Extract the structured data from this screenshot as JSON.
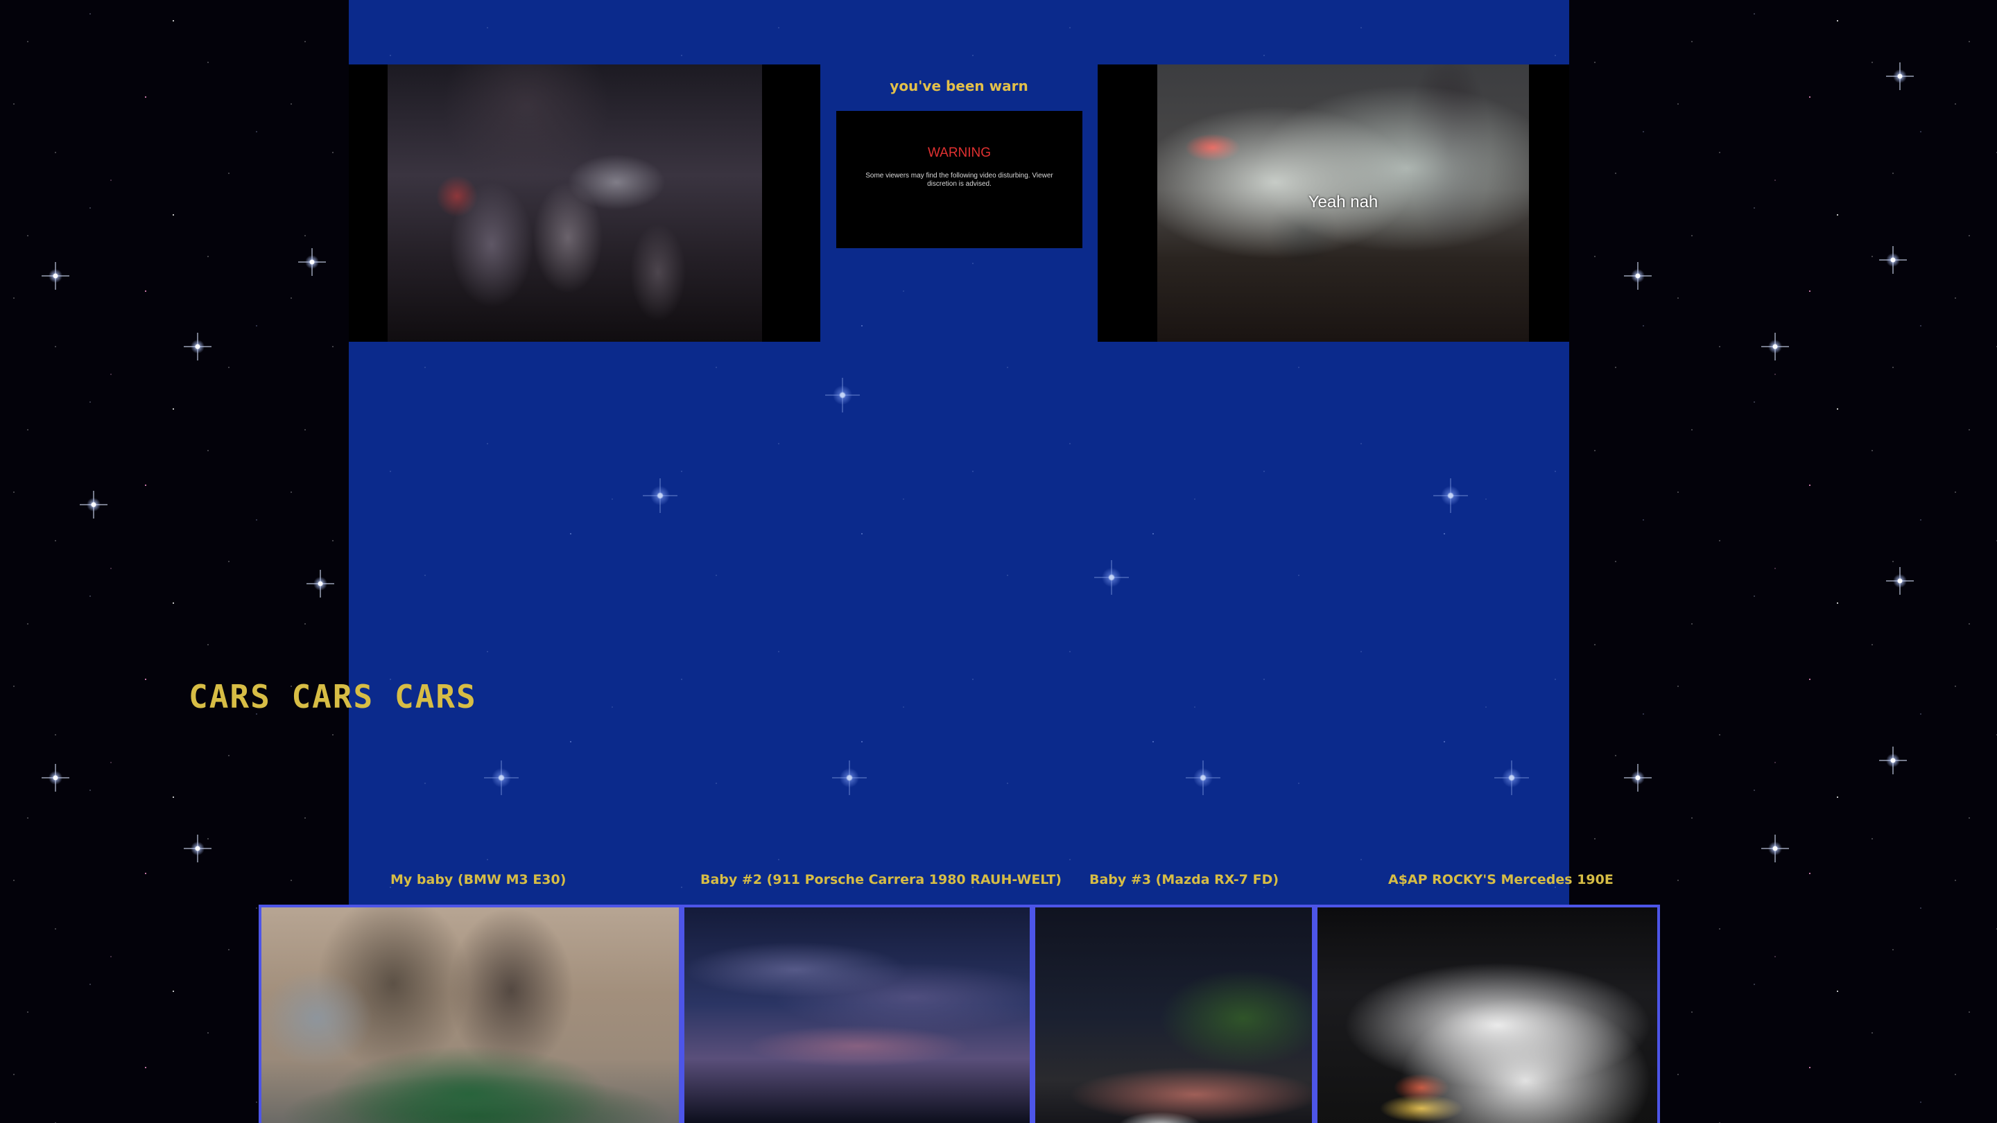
{
  "warning_section": {
    "title": "you've been warn",
    "card_heading": "WARNING",
    "card_body": "Some viewers may find the following video disturbing. Viewer discretion is advised."
  },
  "videos": [
    {
      "caption": ""
    },
    {
      "caption": "Yeah nah"
    }
  ],
  "gallery": {
    "heading": "CARS CARS CARS",
    "items": [
      {
        "label": "My baby (BMW M3 E30)"
      },
      {
        "label": "Baby #2 (911 Porsche Carrera 1980 RAUH-WELT)"
      },
      {
        "label": "Baby #3 (Mazda RX-7 FD)"
      },
      {
        "label": "A$AP ROCKY'S Mercedes 190E"
      }
    ]
  },
  "colors": {
    "panel": "#0b2a8c",
    "accent_gold": "#d7bd45",
    "warning_red": "#e03131",
    "gallery_border": "#4d55e8"
  }
}
